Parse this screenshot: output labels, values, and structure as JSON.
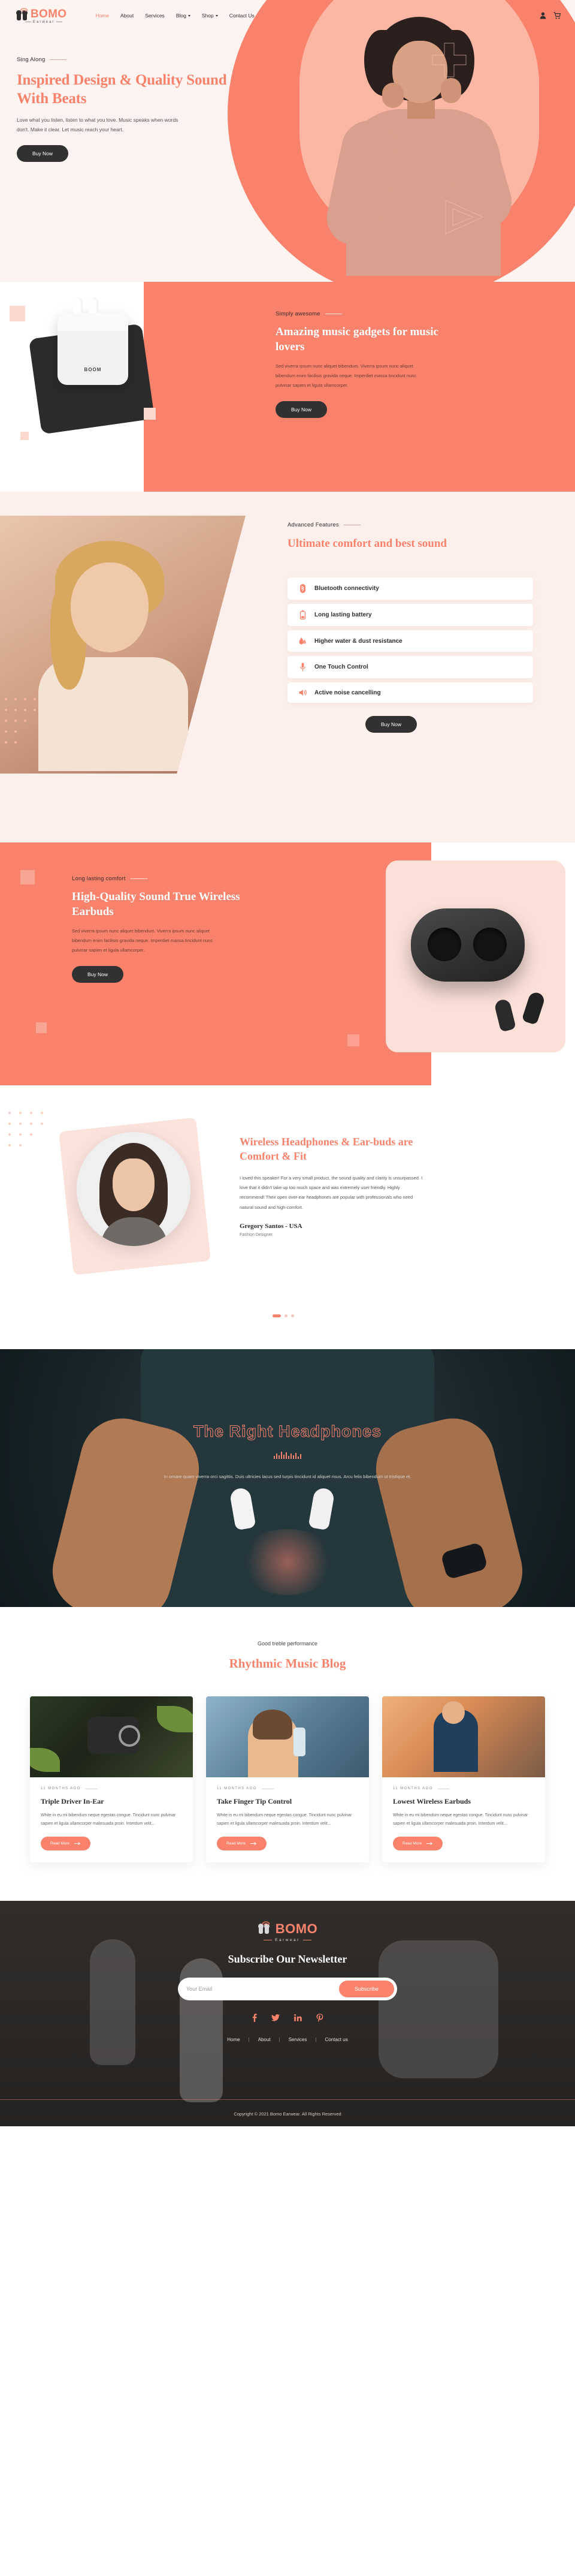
{
  "brand": {
    "name": "BOMO",
    "tagline": "Earwear"
  },
  "nav": {
    "items": [
      {
        "label": "Home",
        "active": true,
        "caret": false
      },
      {
        "label": "About",
        "active": false,
        "caret": false
      },
      {
        "label": "Services",
        "active": false,
        "caret": false
      },
      {
        "label": "Blog",
        "active": false,
        "caret": true
      },
      {
        "label": "Shop",
        "active": false,
        "caret": true
      },
      {
        "label": "Contact Us",
        "active": false,
        "caret": false
      }
    ],
    "icons": [
      "user-icon",
      "cart-icon"
    ]
  },
  "hero": {
    "eyebrow": "Sing Along",
    "title": "Inspired Design & Quality Sound With Beats",
    "paragraph": "Love what you listen, listen to what you love. Music speaks when words don't. Make it clear. Let music reach your heart.",
    "cta": "Buy Now"
  },
  "gadgets": {
    "eyebrow": "Simply awesome",
    "title": "Amazing music gadgets for music lovers",
    "paragraph": "Sed viverra ipsum nunc aliquet bibendum. Viverra ipsum nunc aliquet bibendum enim facilisis gravida neque. Imperdiet massa tincidunt nunc pulvinar sapien et ligula ullamcorper.",
    "cta": "Buy Now",
    "product_label": "BOOM"
  },
  "features": {
    "eyebrow": "Advanced Features",
    "title": "Ultimate comfort and best sound",
    "cta": "Buy Now",
    "items": [
      {
        "label": "Bluetooth connectivity",
        "icon": "bluetooth-icon"
      },
      {
        "label": "Long lasting battery",
        "icon": "battery-icon"
      },
      {
        "label": "Higher water & dust resistance",
        "icon": "water-drop-icon"
      },
      {
        "label": "One Touch Control",
        "icon": "microphone-icon"
      },
      {
        "label": "Active noise cancelling",
        "icon": "speaker-icon"
      }
    ]
  },
  "quality": {
    "eyebrow": "Long lasting comfort",
    "title": "High-Quality Sound True Wireless Earbuds",
    "paragraph": "Sed viverra ipsum nunc aliquet bibendum. Viverra ipsum nunc aliquet bibendum enim facilisis gravida neque. Imperdiet massa tincidunt nunc pulvinar sapien et ligula ullamcorper.",
    "cta": "Buy Now"
  },
  "testimonial": {
    "title": "Wireless Headphones & Ear-buds are Comfort & Fit",
    "quote": "I loved this speaker! For a very small product, the sound quality and clarity is unsurpassed. I love that it didn't take up too much space and was extremely user friendly. Highly recommend! Their open over-ear headphones are popular with professionals who need natural sound and high-comfort.",
    "author": "Gregory Santos - USA",
    "role": "Fashion Designer"
  },
  "banner": {
    "title": "The Right Headphones",
    "paragraph": "In ornare quam viverra orci sagittis. Duis ultricies lacus sed turpis tincidunt id aliquet risus. Arcu felis bibendum ut tristique et."
  },
  "blog": {
    "eyebrow": "Good treble performance",
    "title": "Rhythmic Music Blog",
    "posts": [
      {
        "meta": "11 MONTHS AGO",
        "title": "Triple Driver In-Ear",
        "excerpt": "White in eu mi bibendum neque egestas congue. Tincidunt nunc pulvinar sapien et ligula ullamcorper malesuada proin. Interdum velit...",
        "cta": "Read More"
      },
      {
        "meta": "11 MONTHS AGO",
        "title": "Take Finger Tip Control",
        "excerpt": "White in eu mi bibendum neque egestas congue. Tincidunt nunc pulvinar sapien et ligula ullamcorper malesuada proin. Interdum velit...",
        "cta": "Read More"
      },
      {
        "meta": "11 MONTHS AGO",
        "title": "Lowest Wireless Earbuds",
        "excerpt": "White in eu mi bibendum neque egestas congue. Tincidunt nunc pulvinar sapien et ligula ullamcorper malesuada proin. Interdum velit...",
        "cta": "Read More"
      }
    ]
  },
  "footer": {
    "heading": "Subscribe Our Newsletter",
    "email_placeholder": "Your Email",
    "subscribe_label": "Subscribe",
    "socials": [
      {
        "name": "facebook-icon",
        "glyph": "f"
      },
      {
        "name": "twitter-icon",
        "glyph": "ᵛ"
      },
      {
        "name": "linkedin-icon",
        "glyph": "in"
      },
      {
        "name": "pinterest-icon",
        "glyph": "℘"
      }
    ],
    "links": [
      "Home",
      "About",
      "Services",
      "Contact us"
    ],
    "separator": "|",
    "copyright": "Copyright © 2021 Bomo Earwear. All Rights Reserved"
  },
  "colors": {
    "accent": "#f9826c",
    "dark": "#313131",
    "soft": "#fdf0ec"
  }
}
